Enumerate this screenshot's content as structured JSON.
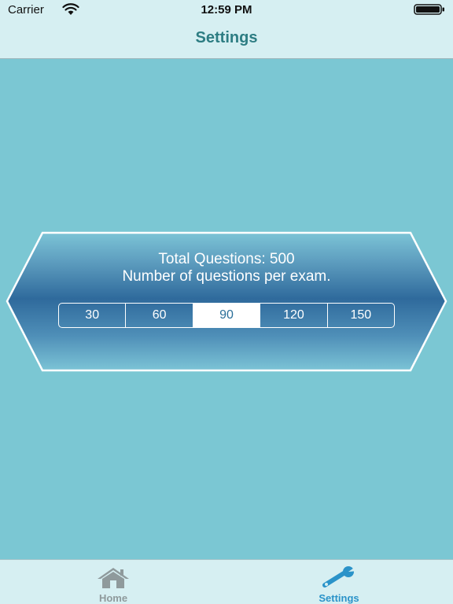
{
  "status_bar": {
    "carrier": "Carrier",
    "time": "12:59 PM",
    "wifi_icon": "wifi-icon",
    "battery_icon": "battery-full-icon"
  },
  "nav": {
    "title": "Settings"
  },
  "settings": {
    "total_questions": "Total Questions: 500",
    "description": "Number of questions per exam.",
    "options": [
      "30",
      "60",
      "90",
      "120",
      "150"
    ],
    "selected": "90"
  },
  "tabbar": {
    "tabs": [
      {
        "label": "Home",
        "icon": "home-icon",
        "active": false
      },
      {
        "label": "Settings",
        "icon": "wrench-icon",
        "active": true
      }
    ]
  },
  "colors": {
    "background": "#7bc7d3",
    "bar": "#d6eff2",
    "title": "#2d7d83",
    "banner_dark": "#2f6a9c",
    "active_tab": "#2a93c9",
    "inactive_tab": "#8f9a9c"
  }
}
